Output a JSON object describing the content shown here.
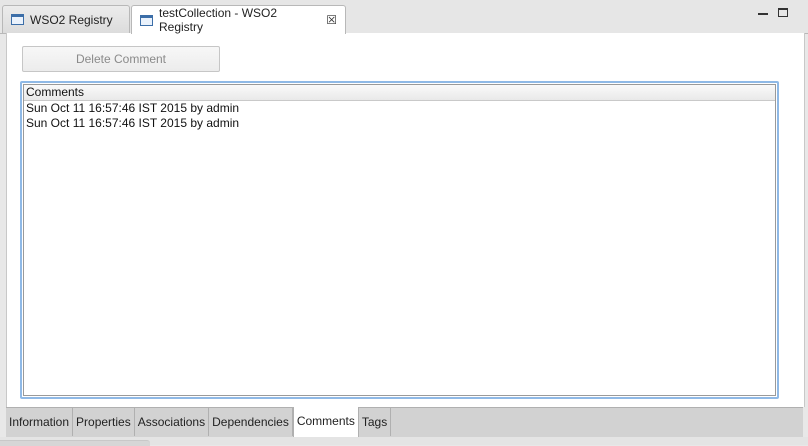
{
  "editor_tabs": [
    {
      "label": "WSO2 Registry",
      "icon": "window-icon",
      "active": false
    },
    {
      "label": "testCollection - WSO2 Registry",
      "icon": "window-icon",
      "active": true,
      "close_icon": "close-icon"
    }
  ],
  "toolbar": {
    "delete_comment_label": "Delete Comment",
    "delete_comment_enabled": false
  },
  "comments": {
    "header": "Comments",
    "rows": [
      "Sun Oct 11 16:57:46 IST 2015 by admin",
      "Sun Oct 11 16:57:46 IST 2015 by admin"
    ]
  },
  "bottom_tabs": [
    {
      "label": "Information",
      "active": false
    },
    {
      "label": "Properties",
      "active": false
    },
    {
      "label": "Associations",
      "active": false
    },
    {
      "label": "Dependencies",
      "active": false
    },
    {
      "label": "Comments",
      "active": true
    },
    {
      "label": "Tags",
      "active": false
    }
  ],
  "colors": {
    "focus_border": "#8fb9e6",
    "tab_bar": "#d2d2d2",
    "disabled_text": "#8a8a8a"
  }
}
